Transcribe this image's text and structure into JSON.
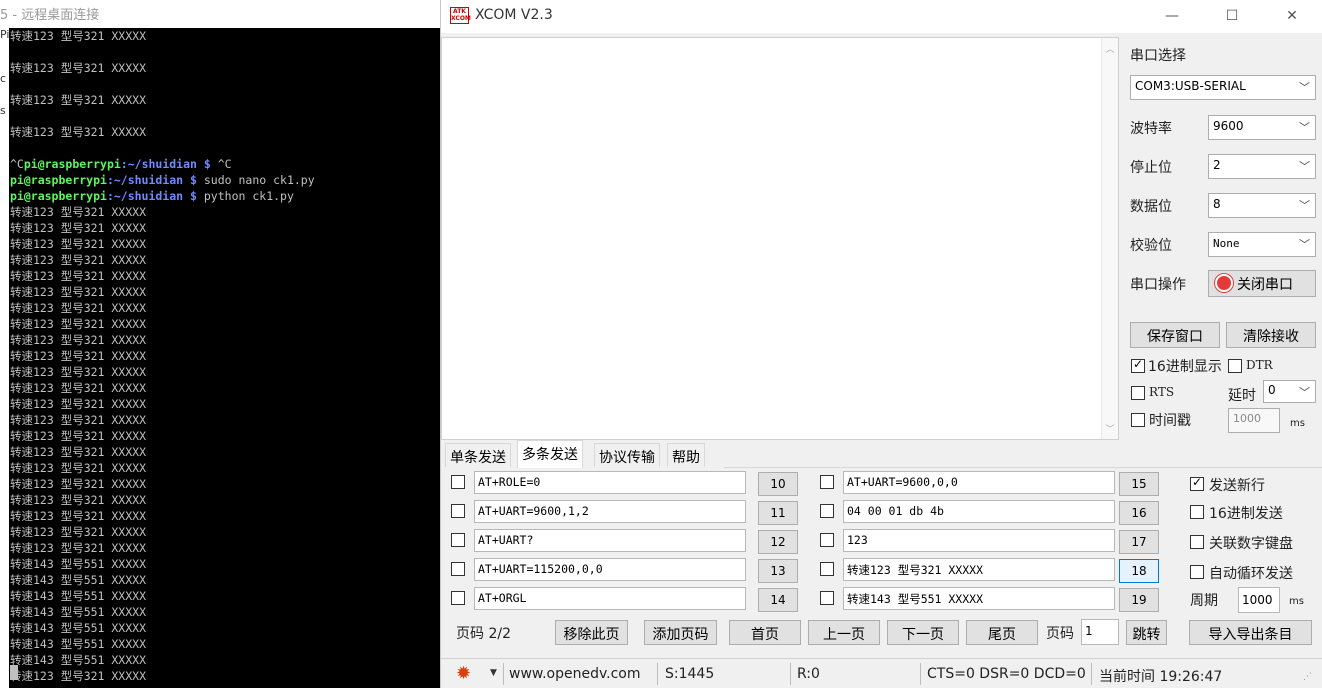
{
  "rdp": {
    "title": "5 - 远程桌面连接",
    "left_strip": [
      "Pi",
      "c",
      "s"
    ]
  },
  "terminal": {
    "lines": [
      {
        "text": "转速123 型号321 XXXXX"
      },
      {
        "text": ""
      },
      {
        "text": "转速123 型号321 XXXXX"
      },
      {
        "text": ""
      },
      {
        "text": "转速123 型号321 XXXXX"
      },
      {
        "text": ""
      },
      {
        "text": "转速123 型号321 XXXXX"
      },
      {
        "text": ""
      },
      {
        "pre": "^C",
        "user": "pi@raspberrypi",
        "path": ":~/shuidian $",
        "cmd": " ^C"
      },
      {
        "user": "pi@raspberrypi",
        "path": ":~/shuidian $",
        "cmd": " sudo nano ck1.py"
      },
      {
        "user": "pi@raspberrypi",
        "path": ":~/shuidian $",
        "cmd": " python ck1.py"
      },
      {
        "text": "转速123 型号321 XXXXX"
      },
      {
        "text": "转速123 型号321 XXXXX"
      },
      {
        "text": "转速123 型号321 XXXXX"
      },
      {
        "text": "转速123 型号321 XXXXX"
      },
      {
        "text": "转速123 型号321 XXXXX"
      },
      {
        "text": "转速123 型号321 XXXXX"
      },
      {
        "text": "转速123 型号321 XXXXX"
      },
      {
        "text": "转速123 型号321 XXXXX"
      },
      {
        "text": "转速123 型号321 XXXXX"
      },
      {
        "text": "转速123 型号321 XXXXX"
      },
      {
        "text": "转速123 型号321 XXXXX"
      },
      {
        "text": "转速123 型号321 XXXXX"
      },
      {
        "text": "转速123 型号321 XXXXX"
      },
      {
        "text": "转速123 型号321 XXXXX"
      },
      {
        "text": "转速123 型号321 XXXXX"
      },
      {
        "text": "转速123 型号321 XXXXX"
      },
      {
        "text": "转速123 型号321 XXXXX"
      },
      {
        "text": "转速123 型号321 XXXXX"
      },
      {
        "text": "转速123 型号321 XXXXX"
      },
      {
        "text": "转速123 型号321 XXXXX"
      },
      {
        "text": "转速123 型号321 XXXXX"
      },
      {
        "text": "转速123 型号321 XXXXX"
      },
      {
        "text": "转速143 型号551 XXXXX"
      },
      {
        "text": "转速143 型号551 XXXXX"
      },
      {
        "text": "转速143 型号551 XXXXX"
      },
      {
        "text": "转速143 型号551 XXXXX"
      },
      {
        "text": "转速143 型号551 XXXXX"
      },
      {
        "text": "转速143 型号551 XXXXX"
      },
      {
        "text": "转速143 型号551 XXXXX"
      },
      {
        "text": "转速123 型号321 XXXXX"
      }
    ]
  },
  "xcom": {
    "logo": "ATK XCOM",
    "title": "XCOM V2.3",
    "window_buttons": {
      "minimize": "—",
      "maximize": "☐",
      "close": "✕"
    },
    "right_panel": {
      "port_select_label": "串口选择",
      "port_value": "COM3:USB-SERIAL",
      "baud_label": "波特率",
      "baud_value": "9600",
      "stop_label": "停止位",
      "stop_value": "2",
      "data_label": "数据位",
      "data_value": "8",
      "parity_label": "校验位",
      "parity_value": "None",
      "port_op_label": "串口操作",
      "close_port_btn": "关闭串口",
      "save_window_btn": "保存窗口",
      "clear_recv_btn": "清除接收",
      "hex_display": "16进制显示",
      "hex_display_checked": true,
      "dtr": "DTR",
      "rts": "RTS",
      "delay_label": "延时",
      "delay_value": "0",
      "timestamp": "时间戳",
      "timestamp_value": "1000",
      "ms": "ms"
    },
    "tabs": [
      "单条发送",
      "多条发送",
      "协议传输",
      "帮助"
    ],
    "active_tab": 1,
    "multi_send": {
      "col1": [
        {
          "text": "AT+ROLE=0",
          "num": "10"
        },
        {
          "text": "AT+UART=9600,1,2",
          "num": "11"
        },
        {
          "text": "AT+UART?",
          "num": "12"
        },
        {
          "text": "AT+UART=115200,0,0",
          "num": "13"
        },
        {
          "text": "AT+ORGL",
          "num": "14"
        }
      ],
      "col2": [
        {
          "text": "AT+UART=9600,0,0",
          "num": "15"
        },
        {
          "text": "04 00 01 db 4b",
          "num": "16"
        },
        {
          "text": "123",
          "num": "17"
        },
        {
          "text": "转速123 型号321 XXXXX",
          "num": "18"
        },
        {
          "text": "转速143 型号551 XXXXX",
          "num": "19"
        }
      ],
      "send_newline": "发送新行",
      "send_newline_checked": true,
      "hex_send": "16进制发送",
      "link_keypad": "关联数字键盘",
      "auto_loop": "自动循环发送",
      "period_label": "周期",
      "period_value": "1000",
      "ms": "ms",
      "page_label": "页码",
      "page_value": "2/2",
      "remove_page": "移除此页",
      "add_page": "添加页码",
      "first_page": "首页",
      "prev_page": "上一页",
      "next_page": "下一页",
      "last_page": "尾页",
      "goto_label": "页码",
      "goto_value": "1",
      "jump": "跳转",
      "import_export": "导入导出条目"
    },
    "status": {
      "url": "www.openedv.com",
      "sent": "S:1445",
      "recv": "R:0",
      "signals": "CTS=0 DSR=0 DCD=0",
      "time": "当前时间 19:26:47"
    },
    "colors": {
      "accent": "#e23b3b",
      "focus": "#0078d7"
    }
  }
}
